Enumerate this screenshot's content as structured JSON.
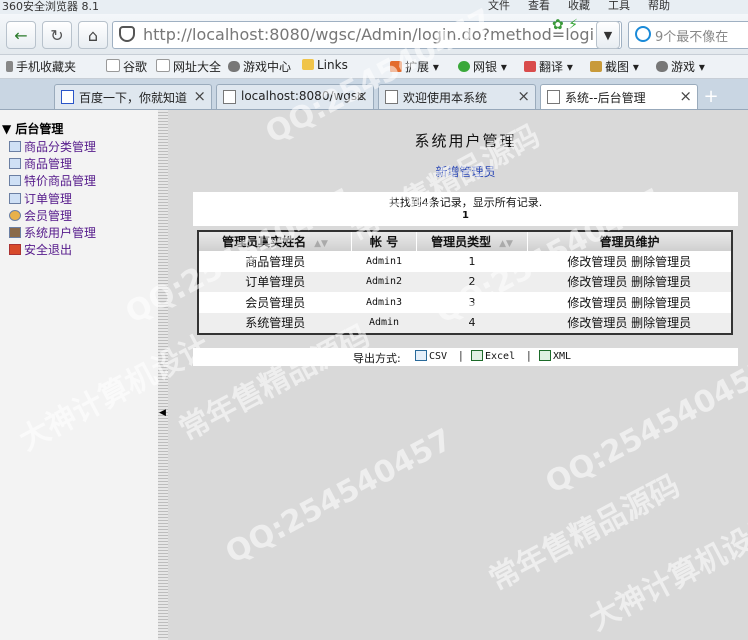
{
  "window": {
    "app_title": "360安全浏览器 8.1",
    "menu": [
      "文件",
      "查看",
      "收藏",
      "工具",
      "帮助"
    ]
  },
  "nav": {
    "url_host": "http://localhost",
    "url_rest": ":8080/wgsc/Admin/login.do?method=logi",
    "search_placeholder": "9个最不像在"
  },
  "bookmarks": [
    "手机收藏夹",
    "谷歌",
    "网址大全",
    "游戏中心",
    "Links",
    "扩展",
    "网银",
    "翻译",
    "截图",
    "游戏"
  ],
  "tabs": [
    {
      "title": "百度一下，你就知道",
      "active": false
    },
    {
      "title": "localhost:8080/wgsc",
      "active": false
    },
    {
      "title": "欢迎使用本系统",
      "active": false
    },
    {
      "title": "系统--后台管理",
      "active": true
    }
  ],
  "sidebar": {
    "title": "后台管理",
    "items": [
      "商品分类管理",
      "商品管理",
      "特价商品管理",
      "订单管理",
      "会员管理",
      "系统用户管理",
      "安全退出"
    ]
  },
  "main": {
    "title": "系统用户管理",
    "add_link": "新增管理员",
    "record_info": "共找到4条记录，显示所有记录.",
    "page_number": "1",
    "columns": [
      "管理员真实姓名",
      "帐 号",
      "管理员类型",
      "管理员维护"
    ],
    "rows": [
      {
        "name": "商品管理员",
        "account": "Admin1",
        "type": "1",
        "edit": "修改管理员",
        "delete": "删除管理员"
      },
      {
        "name": "订单管理员",
        "account": "Admin2",
        "type": "2",
        "edit": "修改管理员",
        "delete": "删除管理员"
      },
      {
        "name": "会员管理员",
        "account": "Admin3",
        "type": "3",
        "edit": "修改管理员",
        "delete": "删除管理员"
      },
      {
        "name": "系统管理员",
        "account": "Admin",
        "type": "4",
        "edit": "修改管理员",
        "delete": "删除管理员"
      }
    ],
    "export_label": "导出方式:",
    "export_options": [
      "CSV",
      "Excel",
      "XML"
    ],
    "separator": "|"
  },
  "watermark": {
    "qq": "QQ:254540457",
    "shop": "常年售精品源码",
    "design": "大神计算机设计"
  },
  "colors": {
    "link": "#2745b5",
    "visited": "#551a8b",
    "accent_green": "#2a7a2a"
  }
}
